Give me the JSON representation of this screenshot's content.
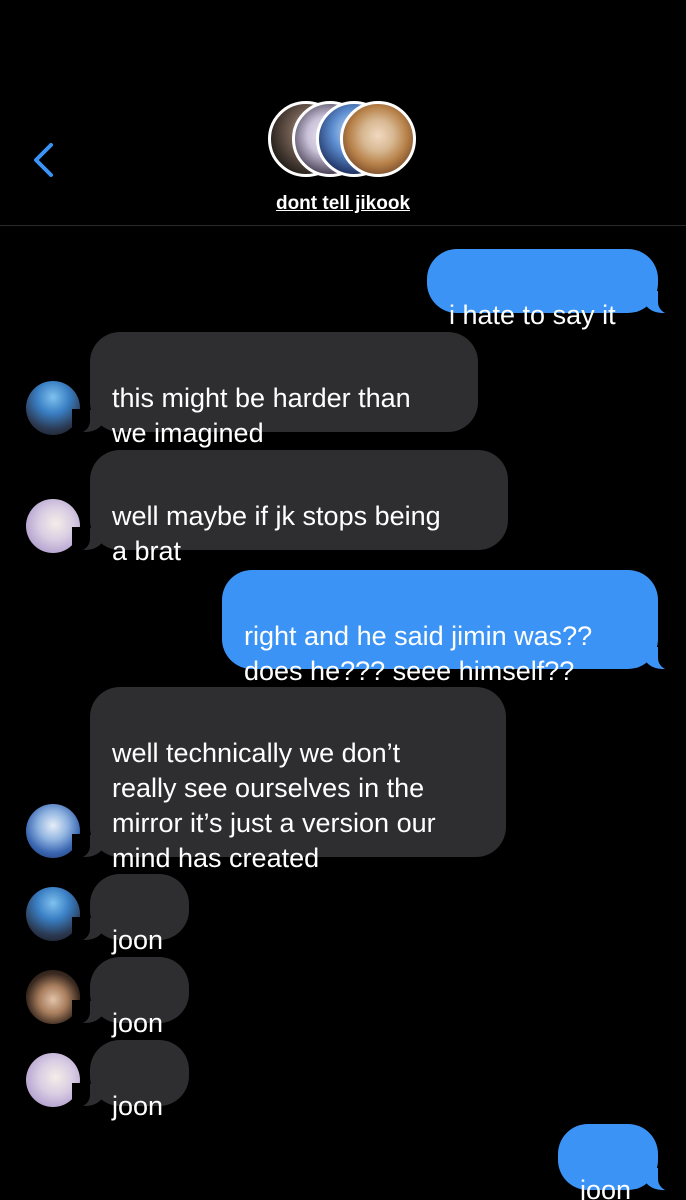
{
  "header": {
    "group_name": "dont tell jikook",
    "colors": {
      "background": "#000000",
      "sent": "#3b93f5",
      "received": "#2e2e30",
      "back_arrow": "#3b93f5"
    }
  },
  "messages": [
    {
      "side": "sent",
      "text": "i hate to say it"
    },
    {
      "side": "received",
      "text": "this might be harder than\nwe imagined",
      "avatar": "blue-hair-avatar"
    },
    {
      "side": "received",
      "text": "well maybe if jk stops being\na brat",
      "avatar": "white-hair-avatar"
    },
    {
      "side": "sent",
      "text": "right and he said jimin was??\ndoes he??? seee himself??"
    },
    {
      "side": "received",
      "text": "well technically we don’t\nreally see ourselves in the\nmirror it’s just a version our\nmind has created",
      "avatar": "blue-outfit-avatar"
    },
    {
      "side": "received",
      "text": "joon",
      "avatar": "blue-hair-avatar"
    },
    {
      "side": "received",
      "text": "joon",
      "avatar": "dark-hair-avatar"
    },
    {
      "side": "received",
      "text": "joon",
      "avatar": "white-hair-avatar"
    },
    {
      "side": "sent",
      "text": "joon"
    }
  ]
}
